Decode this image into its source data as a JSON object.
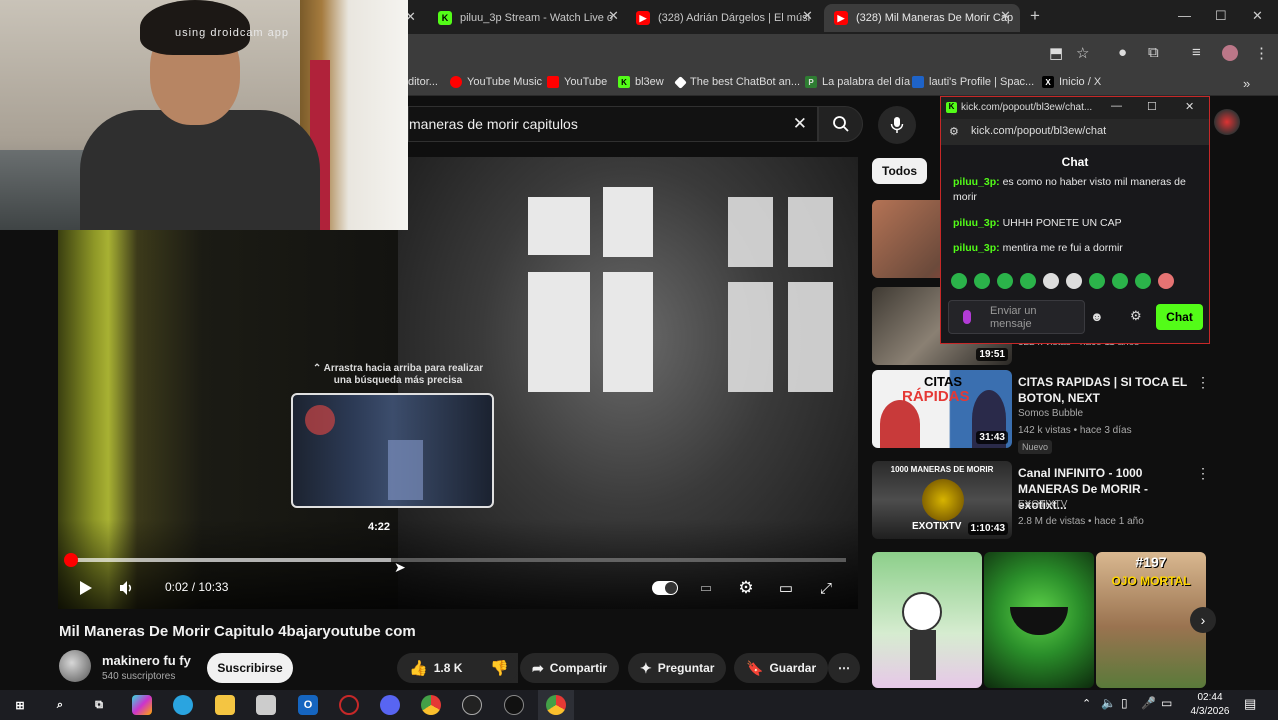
{
  "browser": {
    "tabs": [
      {
        "label": "piluu_3p Stream - Watch Live o"
      },
      {
        "label": "(328) Adrián Dárgelos | El músi"
      },
      {
        "label": "(328) Mil Maneras De Morir Cap"
      }
    ],
    "new_tab": "+",
    "bookmarks": [
      {
        "label": "ditor..."
      },
      {
        "label": "YouTube Music"
      },
      {
        "label": "YouTube"
      },
      {
        "label": "bl3ew"
      },
      {
        "label": "The best ChatBot an..."
      },
      {
        "label": "La palabra del día"
      },
      {
        "label": "lauti's Profile | Spac..."
      },
      {
        "label": "Inicio / X"
      }
    ]
  },
  "webcam": {
    "watermark": "using droidcam app"
  },
  "youtube": {
    "search_query": "maneras de morir capitulos",
    "player": {
      "seek_hint": "⌃ Arrastra hacia arriba para realizar una búsqueda más precisa",
      "preview_time": "4:22",
      "time_display": "0:02 / 10:33",
      "progress_played": 0.003,
      "progress_hover": 0.414
    },
    "video": {
      "title": "Mil Maneras De Morir Capitulo 4bajaryoutube com",
      "channel": "makinero fu fy",
      "subscribers": "540 suscriptores",
      "subscribe_label": "Suscribirse",
      "likes": "1.8 K",
      "share_label": "Compartir",
      "ask_label": "Preguntar",
      "save_label": "Guardar"
    },
    "sidebar": {
      "filter": "Todos",
      "items": [
        {
          "duration": "",
          "title": "",
          "meta1": "",
          "meta2": ""
        },
        {
          "duration": "19:51",
          "title": "",
          "meta1": "",
          "meta2": "322 k vistas • hace 11 años"
        },
        {
          "duration": "31:43",
          "title": "CITAS RAPIDAS | SI TOCA EL BOTON, NEXT",
          "meta1": "Somos Bubble",
          "meta2": "142 k vistas • hace 3 días",
          "badge": "Nuevo",
          "thumb_text1": "CITAS",
          "thumb_text2": "RÁPIDAS"
        },
        {
          "duration": "1:10:43",
          "title": "Canal INFINITO - 1000 MANERAS De MORIR - exotixt...",
          "meta1": "EXOTIXTV",
          "meta2": "2.8 M de vistas • hace 1 año",
          "thumb_text1": "1000 MANERAS DE MORIR",
          "thumb_text2": "EXOTIXTV"
        }
      ],
      "shorts": [
        {
          "overlay": ""
        },
        {
          "overlay": ""
        },
        {
          "overlay": "#197",
          "overlay2": "OJO MORTAL"
        }
      ]
    }
  },
  "kick_popout": {
    "window_title": "kick.com/popout/bl3ew/chat...",
    "url": "kick.com/popout/bl3ew/chat",
    "header": "Chat",
    "messages": [
      {
        "user": "piluu_3p:",
        "text": "es como no haber visto mil maneras de morir"
      },
      {
        "user": "piluu_3p:",
        "text": "UHHH PONETE UN CAP"
      },
      {
        "user": "piluu_3p:",
        "text": "mentira me re fui a dormir"
      }
    ],
    "input_placeholder": "Enviar un mensaje",
    "send_label": "Chat"
  },
  "taskbar": {
    "time": "02:44",
    "date": "4/3/2026"
  }
}
